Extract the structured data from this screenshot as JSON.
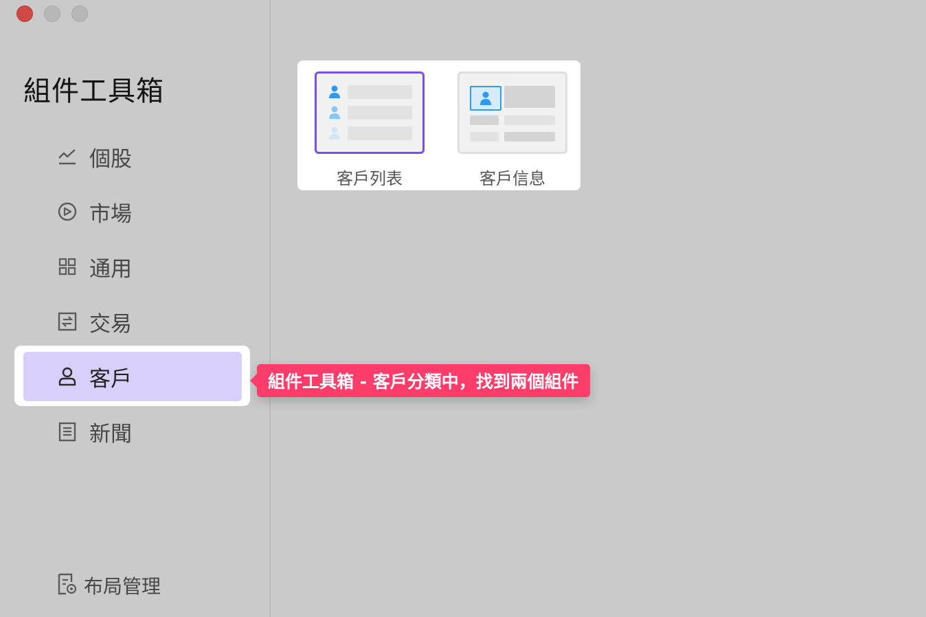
{
  "window": {
    "controls": [
      "close",
      "minimize",
      "zoom"
    ]
  },
  "sidebar": {
    "title": "組件工具箱",
    "items": [
      {
        "label": "個股",
        "icon": "line-chart-icon",
        "active": false
      },
      {
        "label": "市場",
        "icon": "compass-icon",
        "active": false
      },
      {
        "label": "通用",
        "icon": "grid-icon",
        "active": false
      },
      {
        "label": "交易",
        "icon": "exchange-icon",
        "active": false
      },
      {
        "label": "客戶",
        "icon": "user-icon",
        "active": true
      },
      {
        "label": "新聞",
        "icon": "news-icon",
        "active": false
      }
    ],
    "footer": {
      "label": "布局管理",
      "icon": "layout-settings-icon"
    }
  },
  "callout": {
    "text": "組件工具箱 - 客戶分類中，找到兩個組件"
  },
  "widgets": [
    {
      "name": "客戶列表",
      "selected": true
    },
    {
      "name": "客戶信息",
      "selected": false
    }
  ],
  "colors": {
    "accent": "#7a50e6",
    "active_bg": "#d8d0fb",
    "callout": "#ff3d6a",
    "icon_blue": "#2f9bf0"
  }
}
